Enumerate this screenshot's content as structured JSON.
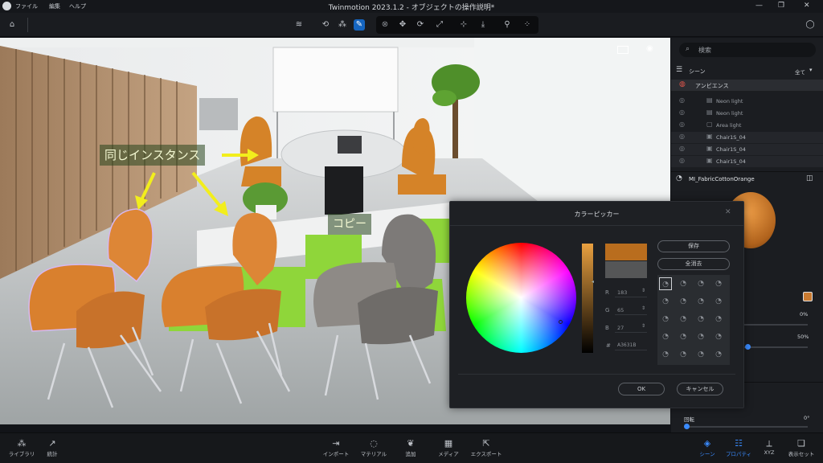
{
  "app": {
    "title": "Twinmotion 2023.1.2 - オブジェクトの操作説明*",
    "menu": [
      "ファイル",
      "編集",
      "ヘルプ"
    ]
  },
  "viewport": {
    "annotation_same_instance": "同じインスタンス",
    "annotation_copy": "コピー"
  },
  "right_panel": {
    "search_placeholder": "検索",
    "scene_label": "シーン",
    "scene_filter": "全て",
    "ambience_label": "アンビエンス",
    "tree_items": [
      "Neon light",
      "Neon light",
      "Area light",
      "Chair1S_04",
      "Chair1S_04",
      "Chair1S_04"
    ],
    "material_name": "MI_FabricCottonOrange",
    "value_1": "0%",
    "value_2": "50%",
    "rotation_label": "回転",
    "rotation_value": "0°"
  },
  "color_picker": {
    "title": "カラーピッカー",
    "r_label": "R",
    "r_value": "183",
    "g_label": "G",
    "g_value": "65",
    "b_label": "B",
    "b_value": "27",
    "hex_label": "#",
    "hex_value": "A3631B",
    "save_label": "保存",
    "clear_label": "全消去",
    "ok_label": "OK",
    "cancel_label": "キャンセル",
    "color_current": "#b96d1e",
    "color_previous": "#555657"
  },
  "bottom_bar": {
    "library": "ライブラリ",
    "stats": "統計",
    "import": "インポート",
    "material": "マテリアル",
    "populate": "追加",
    "media": "メディア",
    "export": "エクスポート",
    "scene": "シーン",
    "properties": "プロパティ",
    "xyz": "XYZ",
    "display_set": "表示セット"
  },
  "colors": {
    "accent": "#3a8bff",
    "chair_orange": "#d9802e",
    "grass_green": "#8fd63a"
  }
}
